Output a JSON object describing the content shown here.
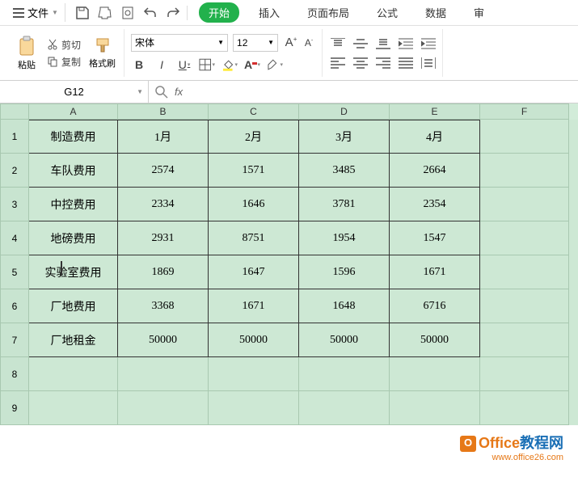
{
  "menubar": {
    "file_label": "文件",
    "tabs": [
      "开始",
      "插入",
      "页面布局",
      "公式",
      "数据",
      "审"
    ]
  },
  "ribbon": {
    "paste_label": "粘贴",
    "cut_label": "剪切",
    "copy_label": "复制",
    "format_painter_label": "格式刷",
    "font_name": "宋体",
    "font_size": "12",
    "bold": "B",
    "italic": "I",
    "underline": "U",
    "increase_font": "A",
    "decrease_font": "A"
  },
  "name_box": {
    "value": "G12"
  },
  "formula_bar": {
    "fx_label": "fx",
    "value": ""
  },
  "grid": {
    "columns": [
      "A",
      "B",
      "C",
      "D",
      "E",
      "F"
    ],
    "row_numbers": [
      "1",
      "2",
      "3",
      "4",
      "5",
      "6",
      "7",
      "8",
      "9"
    ],
    "data": [
      [
        "制造费用",
        "1月",
        "2月",
        "3月",
        "4月"
      ],
      [
        "车队费用",
        "2574",
        "1571",
        "3485",
        "2664"
      ],
      [
        "中控费用",
        "2334",
        "1646",
        "3781",
        "2354"
      ],
      [
        "地磅费用",
        "2931",
        "8751",
        "1954",
        "1547"
      ],
      [
        "实验室费用",
        "1869",
        "1647",
        "1596",
        "1671"
      ],
      [
        "厂地费用",
        "3368",
        "1671",
        "1648",
        "6716"
      ],
      [
        "厂地租金",
        "50000",
        "50000",
        "50000",
        "50000"
      ]
    ]
  },
  "watermark": {
    "text1": "Office",
    "text2": "教程网",
    "url": "www.office26.com"
  },
  "chart_data": {
    "type": "table",
    "title": "制造费用",
    "categories": [
      "1月",
      "2月",
      "3月",
      "4月"
    ],
    "series": [
      {
        "name": "车队费用",
        "values": [
          2574,
          1571,
          3485,
          2664
        ]
      },
      {
        "name": "中控费用",
        "values": [
          2334,
          1646,
          3781,
          2354
        ]
      },
      {
        "name": "地磅费用",
        "values": [
          2931,
          8751,
          1954,
          1547
        ]
      },
      {
        "name": "实验室费用",
        "values": [
          1869,
          1647,
          1596,
          1671
        ]
      },
      {
        "name": "厂地费用",
        "values": [
          3368,
          1671,
          1648,
          6716
        ]
      },
      {
        "name": "厂地租金",
        "values": [
          50000,
          50000,
          50000,
          50000
        ]
      }
    ]
  }
}
